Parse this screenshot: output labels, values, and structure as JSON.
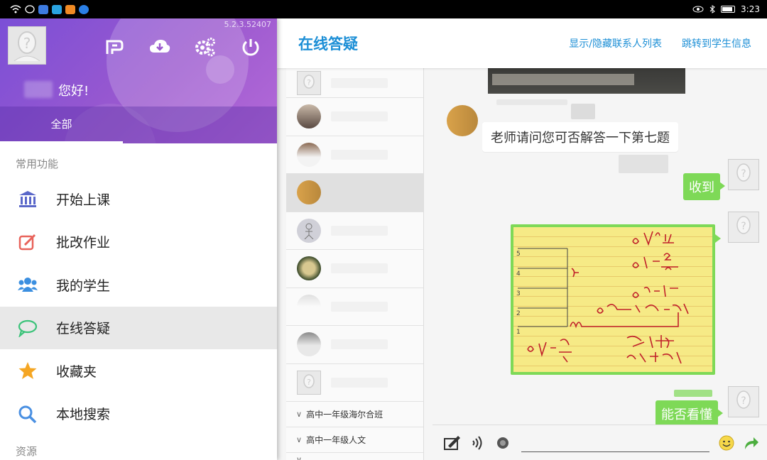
{
  "status_bar": {
    "time": "3:23"
  },
  "drawer": {
    "version": "5.2.3.52407",
    "greeting": "您好!",
    "tab_all": "全部",
    "section_common": "常用功能",
    "menu": [
      {
        "label": "开始上课",
        "icon": "classroom-icon",
        "color": "#5a67c9"
      },
      {
        "label": "批改作业",
        "icon": "edit-icon",
        "color": "#e8625a"
      },
      {
        "label": "我的学生",
        "icon": "students-icon",
        "color": "#3b8fe0"
      },
      {
        "label": "在线答疑",
        "icon": "chat-icon",
        "color": "#3cc37a"
      },
      {
        "label": "收藏夹",
        "icon": "star-icon",
        "color": "#f5a623"
      },
      {
        "label": "本地搜索",
        "icon": "search-icon",
        "color": "#4a90e2"
      }
    ],
    "section_resources": "资源"
  },
  "main": {
    "title": "在线答疑",
    "action_toggle_contacts": "显示/隐藏联系人列表",
    "action_student_info": "跳转到学生信息",
    "groups": [
      "高中一年级海尔合班",
      "高中一年级人文"
    ],
    "messages": {
      "incoming": "老师请问您可否解答一下第七题",
      "reply1": "收到",
      "reply2": "能否看懂"
    },
    "input_placeholder": ""
  },
  "colors": {
    "accent": "#1d8fd6",
    "bubble_out": "#7ed957",
    "drawer_head": "#9b59cf"
  }
}
